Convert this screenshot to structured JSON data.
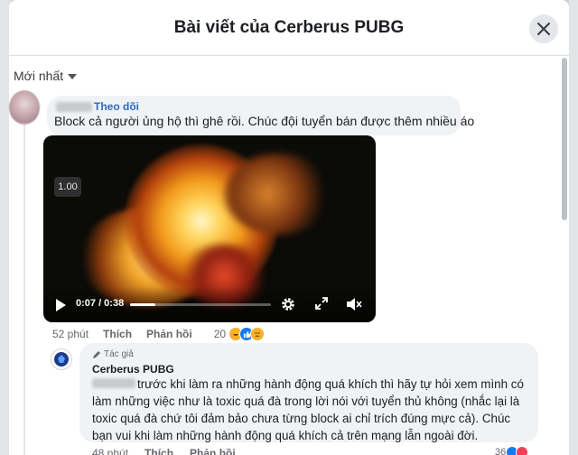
{
  "modal": {
    "title": "Bài viết của Cerberus PUBG"
  },
  "sort": {
    "label": "Mới nhất"
  },
  "comment": {
    "follow_label": "Theo dõi",
    "text": "Block cả người ủng hộ thì ghê rồi. Chúc đội tuyển bán được thêm nhiều áo",
    "video": {
      "speed_badge": "1.00",
      "time": "0:07 / 0:38",
      "progress_fraction": 0.18
    },
    "meta": {
      "time": "52 phút",
      "like_label": "Thích",
      "reply_label": "Phản hồi",
      "reaction_count": "20"
    }
  },
  "reply": {
    "author_tag": "Tác giả",
    "name": "Cerberus PUBG",
    "text": "trước khi làm ra những hành động quá khích thì hãy tự hỏi xem mình có làm những việc như là toxic quá đà trong lời nói với tuyển thủ không (nhắc lại là toxic quá đà chứ tôi đảm bảo chưa từng block ai chỉ trích đúng mực cả). Chúc bạn vui khi làm những hành động quá khích cả trên mạng lẫn ngoài đời.",
    "meta": {
      "time": "48 phút",
      "like_label": "Thích",
      "reply_label": "Phản hồi",
      "reaction_count": "36"
    }
  },
  "colors": {
    "link": "#2c6bbf",
    "bubble": "#f0f2f5",
    "like_reaction": "#1877f2",
    "love_reaction": "#f33e58",
    "haha_reaction": "#f7b125"
  }
}
